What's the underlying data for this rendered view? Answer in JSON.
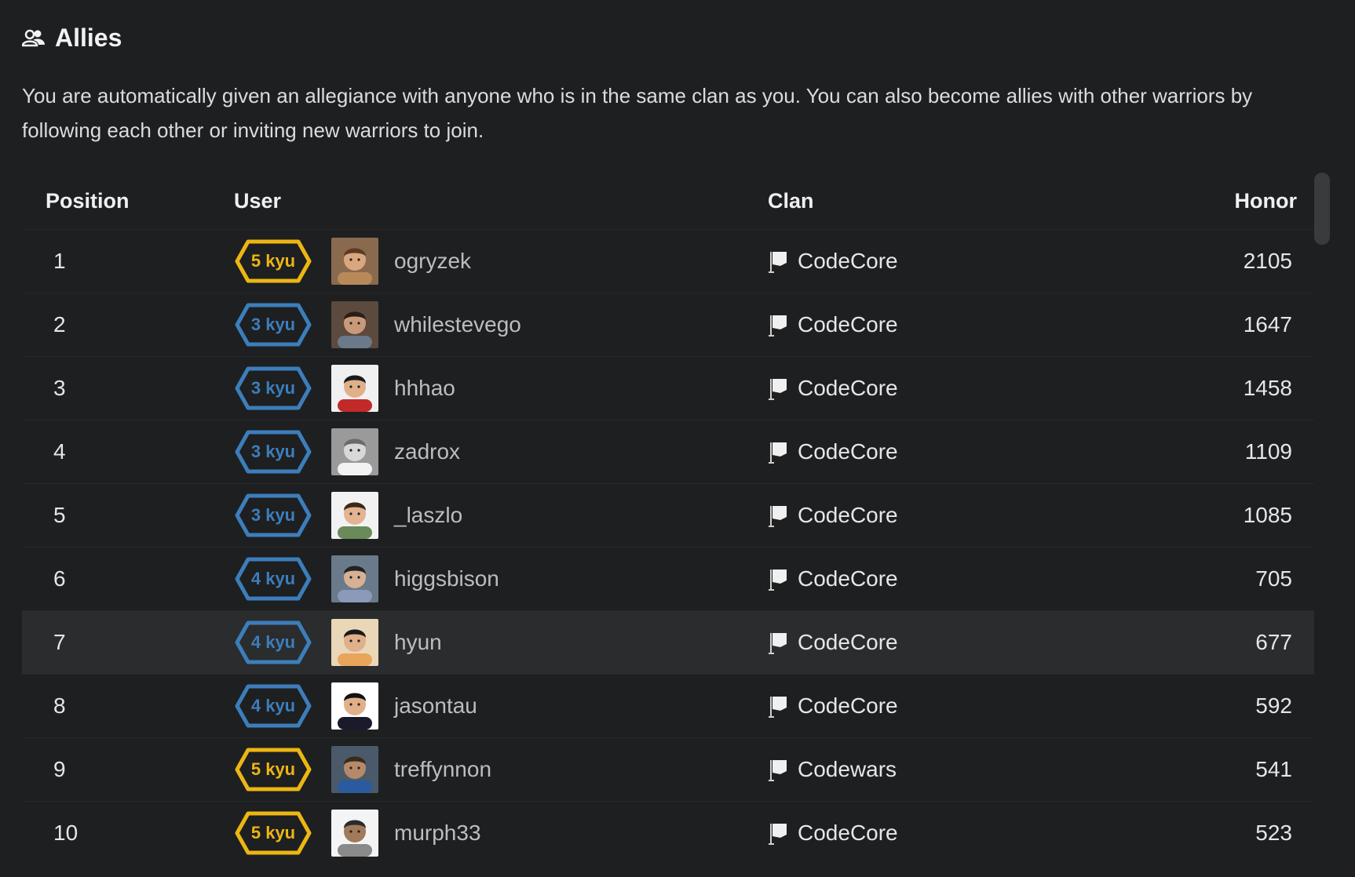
{
  "section": {
    "title": "Allies",
    "icon": "users-icon",
    "description": "You are automatically given an allegiance with anyone who is in the same clan as you. You can also become allies with other warriors by following each other or inviting new warriors to join."
  },
  "table": {
    "headers": {
      "position": "Position",
      "user": "User",
      "clan": "Clan",
      "honor": "Honor"
    },
    "rows": [
      {
        "position": "1",
        "rank": "5 kyu",
        "rank_color": "#ecb613",
        "username": "ogryzek",
        "clan": "CodeCore",
        "honor": "2105",
        "highlighted": false
      },
      {
        "position": "2",
        "rank": "3 kyu",
        "rank_color": "#3c7ebb",
        "username": "whilestevego",
        "clan": "CodeCore",
        "honor": "1647",
        "highlighted": false
      },
      {
        "position": "3",
        "rank": "3 kyu",
        "rank_color": "#3c7ebb",
        "username": "hhhao",
        "clan": "CodeCore",
        "honor": "1458",
        "highlighted": false
      },
      {
        "position": "4",
        "rank": "3 kyu",
        "rank_color": "#3c7ebb",
        "username": "zadrox",
        "clan": "CodeCore",
        "honor": "1109",
        "highlighted": false
      },
      {
        "position": "5",
        "rank": "3 kyu",
        "rank_color": "#3c7ebb",
        "username": "_laszlo",
        "clan": "CodeCore",
        "honor": "1085",
        "highlighted": false
      },
      {
        "position": "6",
        "rank": "4 kyu",
        "rank_color": "#3c7ebb",
        "username": "higgsbison",
        "clan": "CodeCore",
        "honor": "705",
        "highlighted": false
      },
      {
        "position": "7",
        "rank": "4 kyu",
        "rank_color": "#3c7ebb",
        "username": "hyun",
        "clan": "CodeCore",
        "honor": "677",
        "highlighted": true
      },
      {
        "position": "8",
        "rank": "4 kyu",
        "rank_color": "#3c7ebb",
        "username": "jasontau",
        "clan": "CodeCore",
        "honor": "592",
        "highlighted": false
      },
      {
        "position": "9",
        "rank": "5 kyu",
        "rank_color": "#ecb613",
        "username": "treffynnon",
        "clan": "Codewars",
        "honor": "541",
        "highlighted": false
      },
      {
        "position": "10",
        "rank": "5 kyu",
        "rank_color": "#ecb613",
        "username": "murph33",
        "clan": "CodeCore",
        "honor": "523",
        "highlighted": false
      }
    ]
  },
  "colors": {
    "background": "#1e1f21",
    "row_highlight": "#2b2c2e",
    "rank_yellow": "#ecb613",
    "rank_blue": "#3c7ebb"
  }
}
